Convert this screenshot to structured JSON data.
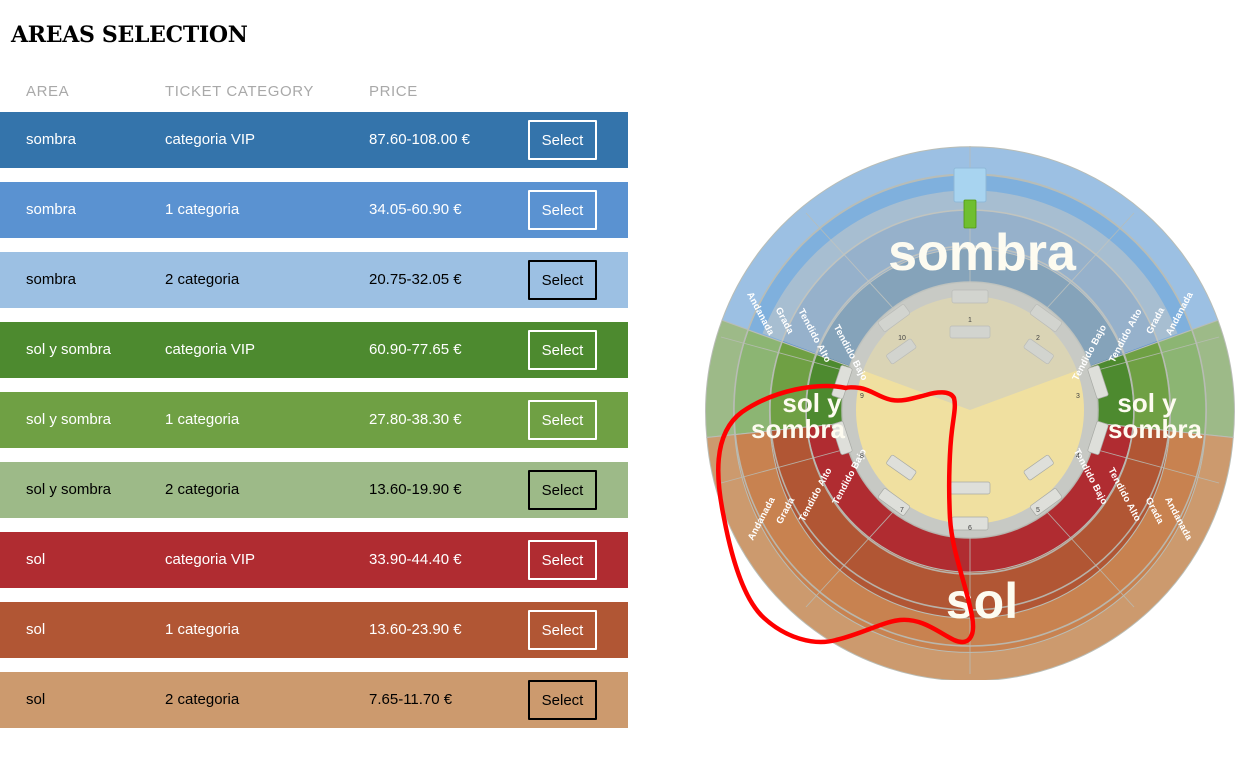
{
  "page": {
    "title": "AREAS SELECTION"
  },
  "table": {
    "columns": {
      "area": "AREA",
      "category": "TICKET CATEGORY",
      "price": "PRICE",
      "action": ""
    },
    "select_label": "Select",
    "groups": [
      {
        "name": "sombra",
        "rows": [
          {
            "area": "sombra",
            "category": "categoria VIP",
            "price": "87.60-108.00 €",
            "select_label": "Select",
            "bg": "#3474ab",
            "text": "#ffffff"
          },
          {
            "area": "sombra",
            "category": "1 categoria",
            "price": "34.05-60.90 €",
            "select_label": "Select",
            "bg": "#5a92d1",
            "text": "#ffffff"
          },
          {
            "area": "sombra",
            "category": "2 categoria",
            "price": "20.75-32.05 €",
            "select_label": "Select",
            "bg": "#9cc0e3",
            "text": "#000000"
          }
        ]
      },
      {
        "name": "sol y sombra",
        "rows": [
          {
            "area": "sol y sombra",
            "category": "categoria VIP",
            "price": "60.90-77.65 €",
            "select_label": "Select",
            "bg": "#4d8a2f",
            "text": "#ffffff"
          },
          {
            "area": "sol y sombra",
            "category": "1 categoria",
            "price": "27.80-38.30 €",
            "select_label": "Select",
            "bg": "#6fa044",
            "text": "#ffffff"
          },
          {
            "area": "sol y sombra",
            "category": "2 categoria",
            "price": "13.60-19.90 €",
            "select_label": "Select",
            "bg": "#9dba88",
            "text": "#000000"
          }
        ]
      },
      {
        "name": "sol",
        "rows": [
          {
            "area": "sol",
            "category": "categoria VIP",
            "price": "33.90-44.40 €",
            "select_label": "Select",
            "bg": "#b02c31",
            "text": "#ffffff"
          },
          {
            "area": "sol",
            "category": "1 categoria",
            "price": "13.60-23.90 €",
            "select_label": "Select",
            "bg": "#b15634",
            "text": "#ffffff"
          },
          {
            "area": "sol",
            "category": "2 categoria",
            "price": "7.65-11.70 €",
            "select_label": "Select",
            "bg": "#cc9a6e",
            "text": "#000000"
          }
        ]
      }
    ]
  },
  "arena": {
    "name": "bullring-seating-map",
    "zones": [
      {
        "label": "sombra",
        "color": "#3b7fbd"
      },
      {
        "label": "sol y sombra",
        "color": "#5a9c3c"
      },
      {
        "label": "sol",
        "color": "#b8562f"
      }
    ],
    "rings": [
      "Andanada",
      "Grada",
      "Tendido Alto",
      "Tendido Bajo"
    ],
    "ring_labels": {
      "andanada": "Andanada",
      "grada": "Grada",
      "tendido_alto": "Tendido Alto",
      "tendido_bajo": "Tendido Bajo"
    },
    "sector_numbers": [
      "1",
      "2",
      "3",
      "4",
      "5",
      "6",
      "7",
      "8",
      "9",
      "10"
    ],
    "colors": {
      "sombra_andanada": "#9cc0e3",
      "sombra_grada": "#7fb0dd",
      "sombra_tendido_alto": "#5a92d1",
      "sombra_tendido_bajo": "#3474ab",
      "solysombra_andanada": "#9dba88",
      "solysombra_grada": "#8cb573",
      "solysombra_tendido_alto": "#6fa044",
      "solysombra_tendido_bajo": "#4d8a2f",
      "sol_andanada": "#cc9a6e",
      "sol_grada": "#c88250",
      "sol_tendido_alto": "#b15634",
      "sol_tendido_bajo": "#b02c31",
      "ruedo": "#f0e0a0",
      "callejon": "#c7c9c4",
      "palco": "#a8d4f0",
      "palco_marker": "#6fbf2f",
      "annotation": "#ff0000"
    },
    "annotation": {
      "name": "hand-drawn-circle",
      "color": "#ff0000",
      "targets": "sol y sombra left sector"
    }
  }
}
